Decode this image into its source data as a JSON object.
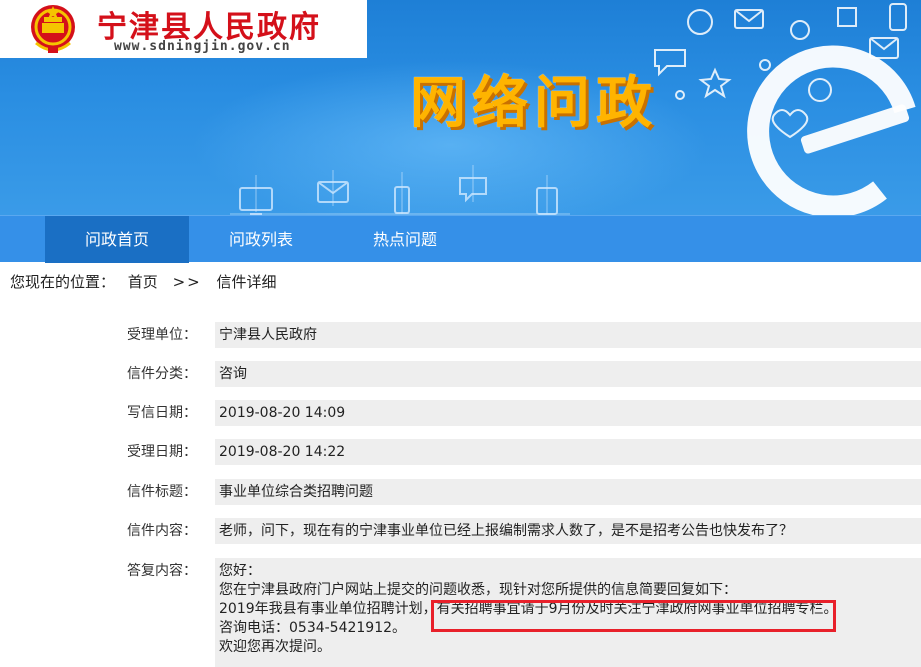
{
  "header": {
    "site_title": "宁津县人民政府",
    "site_url": "www.sdningjin.gov.cn",
    "section_title": "网络问政"
  },
  "nav": {
    "items": [
      {
        "label": "问政首页",
        "active": true
      },
      {
        "label": "问政列表",
        "active": false
      },
      {
        "label": "热点问题",
        "active": false
      }
    ]
  },
  "breadcrumb": {
    "prefix": "您现在的位置：",
    "home": "首页",
    "separator": ">>",
    "current": "信件详细"
  },
  "letter": {
    "unit_label": "受理单位：",
    "unit_value": "宁津县人民政府",
    "category_label": "信件分类：",
    "category_value": "咨询",
    "write_date_label": "写信日期：",
    "write_date_value": "2019-08-20 14:09",
    "accept_date_label": "受理日期：",
    "accept_date_value": "2019-08-20 14:22",
    "title_label": "信件标题：",
    "title_value": "事业单位综合类招聘问题",
    "content_label": "信件内容：",
    "content_value": "老师，问下，现在有的宁津事业单位已经上报编制需求人数了，是不是招考公告也快发布了？",
    "reply_label": "答复内容：",
    "reply_lines": [
      "您好：",
      "您在宁津县政府门户网站上提交的问题收悉，现针对您所提供的信息简要回复如下：",
      "2019年我县有事业单位招聘计划，有关招聘事宜请于9月份及时关注宁津政府网事业单位招聘专栏。",
      "咨询电话：0534-5421912。",
      "欢迎您再次提问。"
    ]
  },
  "colors": {
    "banner_blue": "#2a8ee2",
    "nav_blue": "#3590e8",
    "nav_active": "#1a6fc4",
    "logo_red": "#d4101a",
    "hero_gold": "#ffb400",
    "highlight_red": "#e8202a",
    "row_bg": "#eeeeee"
  }
}
